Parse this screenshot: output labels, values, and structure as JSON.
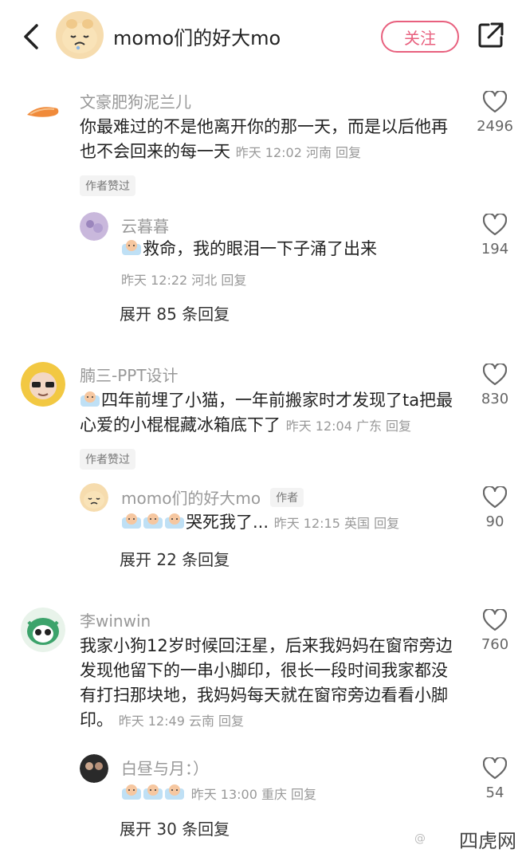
{
  "header": {
    "title": "momo们的好大mo",
    "follow_label": "关注"
  },
  "comments": [
    {
      "name": "文豪肥狗泥兰儿",
      "text": "你最难过的不是他离开你的那一天，而是以后他再也不会回来的每一天",
      "meta": "昨天 12:02 河南 回复",
      "badge": "作者赞过",
      "likes": "2496"
    },
    {
      "name": "云暮暮",
      "text": "救命，我的眼泪一下子涌了出来",
      "meta": "昨天 12:22 河北 回复",
      "likes": "194"
    },
    {
      "expand": "展开 85 条回复"
    },
    {
      "name": "腩三-PPT设计",
      "text": "四年前埋了小猫，一年前搬家时才发现了ta把最心爱的小棍棍藏冰箱底下了",
      "meta": "昨天 12:04 广东 回复",
      "badge": "作者赞过",
      "likes": "830"
    },
    {
      "name": "momo们的好大mo",
      "author_tag": "作者",
      "text": "哭死我了...",
      "meta": "昨天 12:15 英国 回复",
      "likes": "90"
    },
    {
      "expand": "展开 22 条回复"
    },
    {
      "name": "李winwin",
      "text": "我家小狗12岁时候回汪星，后来我妈妈在窗帘旁边发现他留下的一串小脚印，很长一段时间我家都没有打扫那块地，我妈妈每天就在窗帘旁边看看小脚印。",
      "meta": "昨天 12:49 云南 回复",
      "likes": "760"
    },
    {
      "name": "白昼与月：）",
      "text": "",
      "meta": "昨天 13:00 重庆 回复",
      "likes": "54"
    },
    {
      "expand": "展开 30 条回复"
    }
  ],
  "watermark": "四虎网",
  "watermark2": "@",
  "colors": {
    "accent": "#e8607e",
    "muted": "#999999"
  }
}
